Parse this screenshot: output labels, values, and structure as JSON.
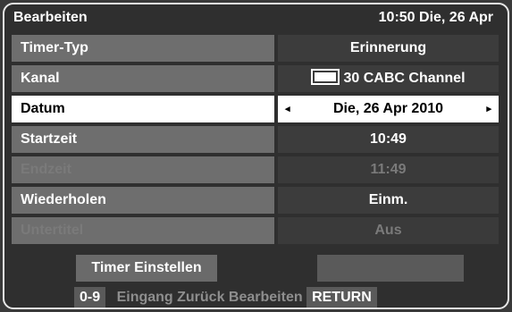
{
  "header": {
    "title": "Bearbeiten",
    "clock": "10:50 Die, 26 Apr"
  },
  "rows": [
    {
      "label": "Timer-Typ",
      "value": "Erinnerung",
      "state": "normal"
    },
    {
      "label": "Kanal",
      "value": "30 CABC Channel",
      "state": "normal",
      "icon": "channel-logo-icon"
    },
    {
      "label": "Datum",
      "value": "Die, 26 Apr 2010",
      "state": "selected",
      "left_arrow": "◂",
      "right_arrow": "▸"
    },
    {
      "label": "Startzeit",
      "value": "10:49",
      "state": "normal"
    },
    {
      "label": "Endzeit",
      "value": "11:49",
      "state": "disabled"
    },
    {
      "label": "Wiederholen",
      "value": "Einm.",
      "state": "normal"
    },
    {
      "label": "Untertitel",
      "value": "Aus",
      "state": "disabled"
    }
  ],
  "set_button": "Timer Einstellen",
  "footer": {
    "key1": "0-9",
    "text1": "Eingang Zurück Bearbeiten",
    "key2": "RETURN"
  },
  "colors": {
    "selected_bg": "#ffffff",
    "row_label_bg": "#6e6e6e",
    "row_value_bg": "#3c3c3c"
  }
}
